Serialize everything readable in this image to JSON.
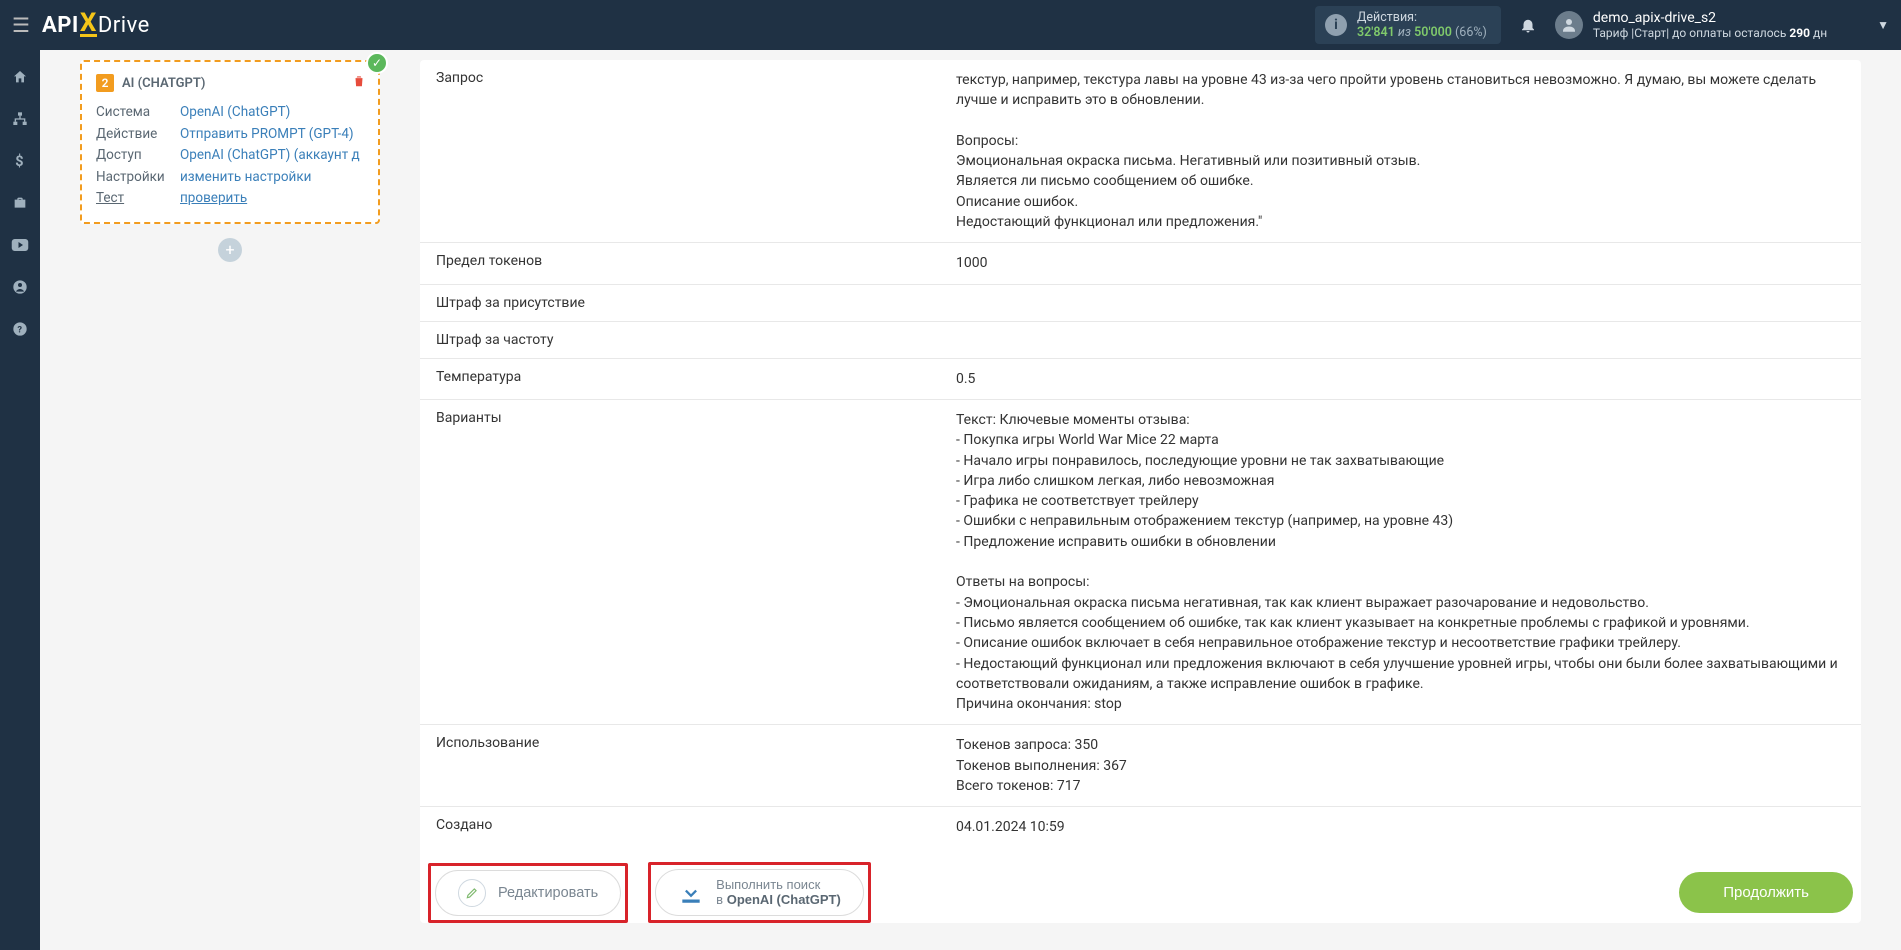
{
  "header": {
    "logo": {
      "part1": "API",
      "part2": "X",
      "part3": "Drive"
    },
    "actions": {
      "label": "Действия:",
      "used": "32'841",
      "of": "из",
      "total": "50'000",
      "pct": "(66%)"
    },
    "user": {
      "name": "demo_apix-drive_s2",
      "plan_prefix": "Тариф |",
      "plan_name": "Старт",
      "plan_mid": "| до оплаты осталось ",
      "days": "290",
      "days_suffix": " дн"
    }
  },
  "sidebar_icons": [
    "home",
    "sitemap",
    "dollar",
    "briefcase",
    "youtube",
    "user",
    "question"
  ],
  "card": {
    "step": "2",
    "title": "AI (CHATGPT)",
    "rows": {
      "system": {
        "k": "Система",
        "v": "OpenAI (ChatGPT)"
      },
      "action": {
        "k": "Действие",
        "v": "Отправить PROMPT (GPT-4)"
      },
      "access": {
        "k": "Доступ",
        "v": "OpenAI (ChatGPT) (аккаунт д"
      },
      "settings": {
        "k": "Настройки",
        "v": "изменить настройки"
      },
      "test": {
        "k": "Тест",
        "v": "проверить"
      }
    }
  },
  "details": {
    "request": {
      "k": "Запрос",
      "v": "текстур, например, текстура лавы на уровне 43 из-за чего пройти уровень становиться невозможно. Я думаю, вы можете сделать лучше и исправить это в обновлении.\n\nВопросы:\nЭмоциональная окраска письма. Негативный или позитивный отзыв.\nЯвляется ли письмо сообщением об ошибке.\nОписание ошибок.\nНедостающий функционал или предложения.\""
    },
    "token_limit": {
      "k": "Предел токенов",
      "v": "1000"
    },
    "presence_penalty": {
      "k": "Штраф за присутствие",
      "v": ""
    },
    "frequency_penalty": {
      "k": "Штраф за частоту",
      "v": ""
    },
    "temperature": {
      "k": "Температура",
      "v": "0.5"
    },
    "variants": {
      "k": "Варианты",
      "v": "Текст: Ключевые моменты отзыва:\n- Покупка игры World War Mice 22 марта\n- Начало игры понравилось, последующие уровни не так захватывающие\n- Игра либо слишком легкая, либо невозможная\n- Графика не соответствует трейлеру\n- Ошибки с неправильным отображением текстур (например, на уровне 43)\n- Предложение исправить ошибки в обновлении\n\nОтветы на вопросы:\n- Эмоциональная окраска письма негативная, так как клиент выражает разочарование и недовольство.\n- Письмо является сообщением об ошибке, так как клиент указывает на конкретные проблемы с графикой и уровнями.\n- Описание ошибок включает в себя неправильное отображение текстур и несоответствие графики трейлеру.\n- Недостающий функционал или предложения включают в себя улучшение уровней игры, чтобы они были более захватывающими и соответствовали ожиданиям, а также исправление ошибок в графике.\nПричина окончания: stop"
    },
    "usage": {
      "k": "Использование",
      "v": "Токенов запроса: 350\nТокенов выполнения: 367\nВсего токенов: 717"
    },
    "created": {
      "k": "Создано",
      "v": "04.01.2024 10:59"
    }
  },
  "buttons": {
    "edit": "Редактировать",
    "search_line1": "Выполнить поиск",
    "search_line2_prefix": "в ",
    "search_line2_bold": "OpenAI (ChatGPT)",
    "continue": "Продолжить"
  }
}
